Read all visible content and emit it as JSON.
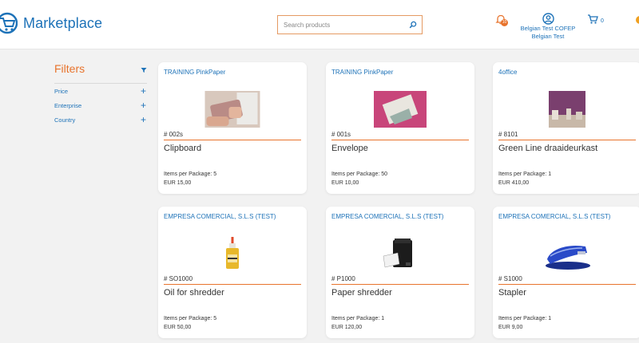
{
  "header": {
    "app_title": "Marketplace",
    "search_placeholder": "Search products",
    "notification_count": "10",
    "user_line1": "Belgian Test COFEP",
    "user_line2": "Belgian Test",
    "cart_count": "0"
  },
  "filters": {
    "title": "Filters",
    "items": [
      {
        "label": "Price"
      },
      {
        "label": "Enterprise"
      },
      {
        "label": "Country"
      }
    ]
  },
  "products": [
    {
      "vendor": "TRAINING PinkPaper",
      "code": "# 002s",
      "name": "Clipboard",
      "package": "Items per Package: 5",
      "price": "EUR 15,00",
      "image": "clipboard-photo"
    },
    {
      "vendor": "TRAINING PinkPaper",
      "code": "# 001s",
      "name": "Envelope",
      "package": "Items per Package: 50",
      "price": "EUR 10,00",
      "image": "envelope-photo"
    },
    {
      "vendor": "4office",
      "code": "# 8101",
      "name": "Green Line draaideurkast",
      "package": "Items per Package: 1",
      "price": "EUR 410,00",
      "image": "cabinet-room-photo"
    },
    {
      "vendor": "EMPRESA COMERCIAL, S.L.S (TEST)",
      "code": "# SO1000",
      "name": "Oil for shredder",
      "package": "Items per Package: 5",
      "price": "EUR 50,00",
      "image": "oil-bottle-photo"
    },
    {
      "vendor": "EMPRESA COMERCIAL, S.L.S (TEST)",
      "code": "# P1000",
      "name": "Paper shredder",
      "package": "Items per Package: 1",
      "price": "EUR 120,00",
      "image": "shredder-photo"
    },
    {
      "vendor": "EMPRESA COMERCIAL, S.L.S (TEST)",
      "code": "# S1000",
      "name": "Stapler",
      "package": "Items per Package: 1",
      "price": "EUR 9,00",
      "image": "stapler-photo"
    }
  ],
  "colors": {
    "brand_blue": "#1d72b8",
    "accent_orange": "#e8732c",
    "background": "#f2f2f2"
  }
}
